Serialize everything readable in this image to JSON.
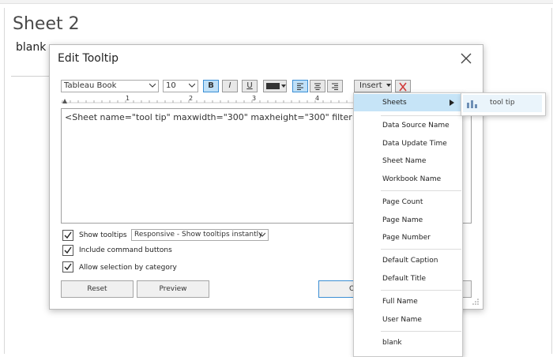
{
  "sheet": {
    "title": "Sheet 2",
    "placeholder": "blank"
  },
  "dialog": {
    "title": "Edit Tooltip",
    "toolbar": {
      "font": "Tableau Book",
      "size": "10",
      "bold": "B",
      "italic": "I",
      "underline": "U",
      "insert": "Insert",
      "font_color": "#333333"
    },
    "ruler": {
      "marks": [
        "1",
        "2",
        "3",
        "4"
      ]
    },
    "editor_text": "<Sheet name=\"tool tip\" maxwidth=\"300\" maxheight=\"300\" filter=",
    "options": {
      "show_tooltips": {
        "label": "Show tooltips",
        "checked": true
      },
      "tooltip_mode": "Responsive - Show tooltips instantly",
      "include_command_buttons": {
        "label": "Include command buttons",
        "checked": true
      },
      "allow_selection": {
        "label": "Allow selection by category",
        "checked": true
      }
    },
    "buttons": {
      "reset": "Reset",
      "preview": "Preview",
      "ok": "O"
    }
  },
  "insert_menu": {
    "items": [
      "Sheets",
      "Data Source Name",
      "Data Update Time",
      "Sheet Name",
      "Workbook Name",
      "Page Count",
      "Page Name",
      "Page Number",
      "Default Caption",
      "Default Title",
      "Full Name",
      "User Name",
      "blank"
    ],
    "highlight_color": "#c6e4f7"
  },
  "submenu": {
    "items": [
      "tool tip"
    ]
  }
}
